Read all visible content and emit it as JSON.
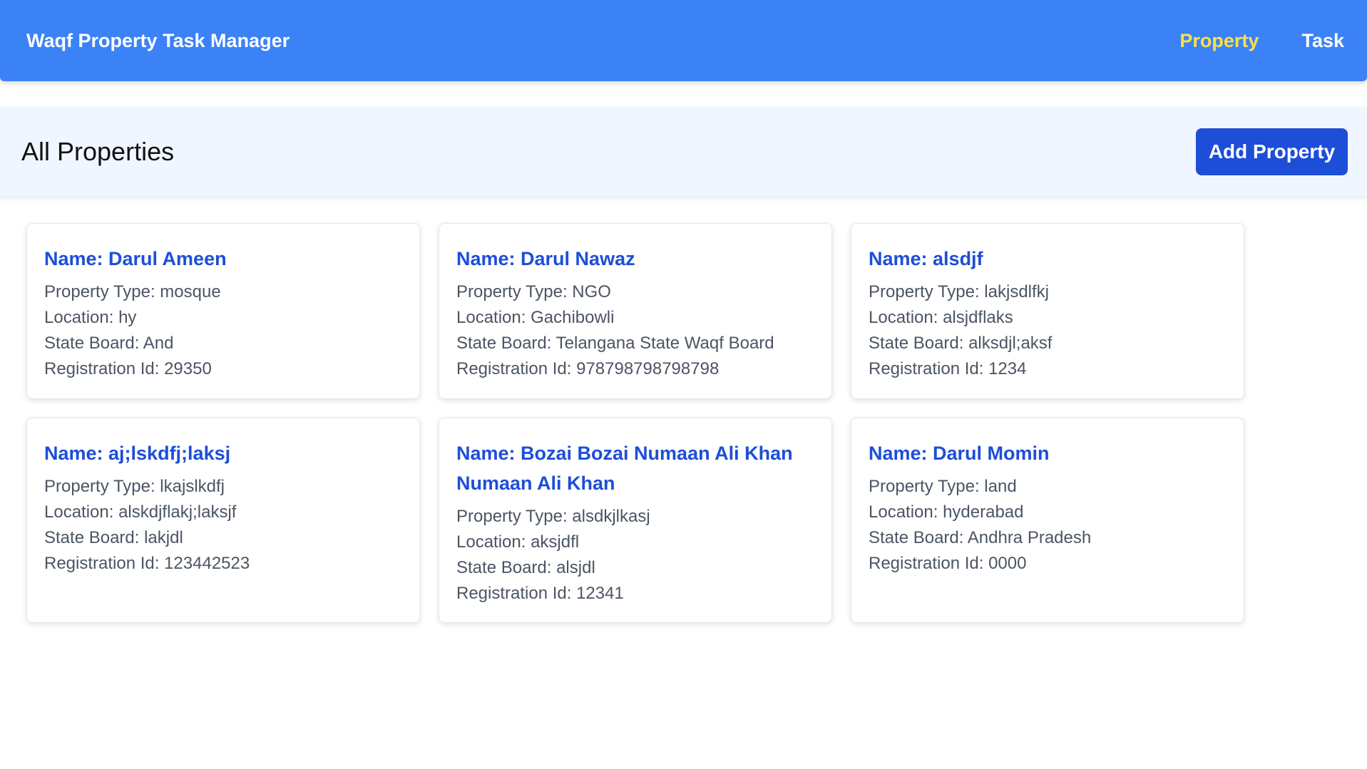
{
  "navbar": {
    "brand": "Waqf Property Task Manager",
    "links": [
      {
        "label": "Property",
        "active": true
      },
      {
        "label": "Task",
        "active": false
      }
    ]
  },
  "header": {
    "title": "All Properties",
    "add_button_label": "Add Property"
  },
  "properties": [
    {
      "name": "Name: Darul Ameen",
      "type": "Property Type: mosque",
      "location": "Location: hy",
      "board": "State Board: And",
      "reg": "Registration Id: 29350"
    },
    {
      "name": "Name: Darul Nawaz",
      "type": "Property Type: NGO",
      "location": "Location: Gachibowli",
      "board": "State Board: Telangana State Waqf Board",
      "reg": "Registration Id: 978798798798798"
    },
    {
      "name": "Name: alsdjf",
      "type": "Property Type: lakjsdlfkj",
      "location": "Location: alsjdflaks",
      "board": "State Board: alksdjl;aksf",
      "reg": "Registration Id: 1234"
    },
    {
      "name": "Name: aj;lskdfj;laksj",
      "type": "Property Type: lkajslkdfj",
      "location": "Location: alskdjflakj;laksjf",
      "board": "State Board: lakjdl",
      "reg": "Registration Id: 123442523"
    },
    {
      "name": "Name: Bozai Bozai Numaan Ali Khan Numaan Ali Khan",
      "type": "Property Type: alsdkjlkasj",
      "location": "Location: aksjdfl",
      "board": "State Board: alsjdl",
      "reg": "Registration Id: 12341"
    },
    {
      "name": "Name: Darul Momin",
      "type": "Property Type: land",
      "location": "Location: hyderabad",
      "board": "State Board: Andhra Pradesh",
      "reg": "Registration Id: 0000"
    }
  ],
  "colors": {
    "navbar": "#3b82f6",
    "active_link": "#fde047",
    "header_bg": "#eff6ff",
    "button": "#1d4ed8",
    "card_title": "#1d4ed8"
  }
}
